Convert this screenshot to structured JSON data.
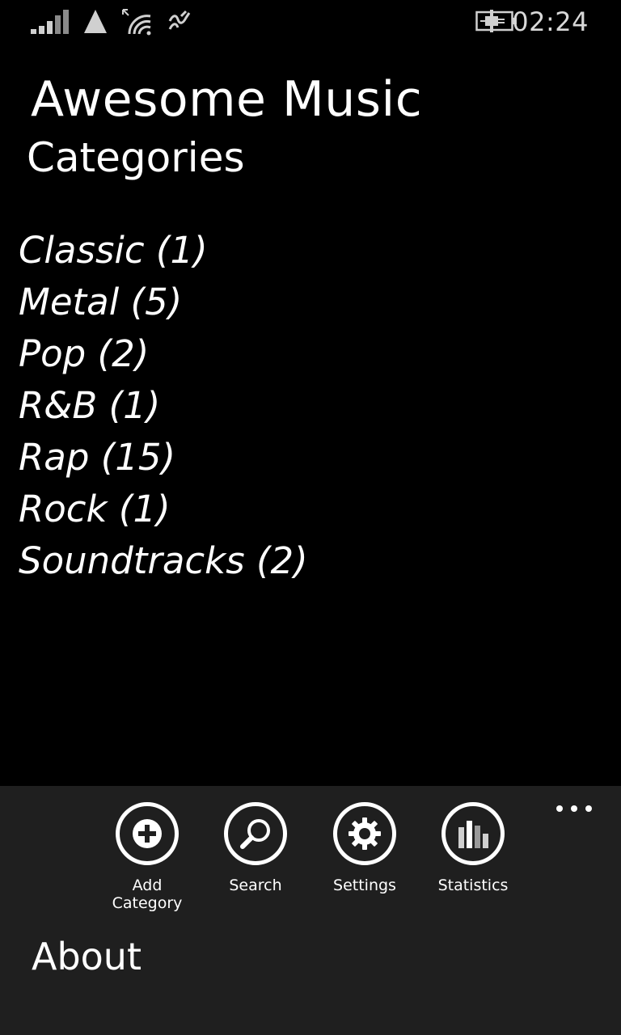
{
  "status_bar": {
    "time": "02:24",
    "icons": [
      "signal-strength-icon",
      "network-triangle-icon",
      "wifi-icon",
      "data-sync-icon",
      "battery-charging-icon"
    ]
  },
  "header": {
    "app_title": "Awesome Music",
    "page_title": "Categories"
  },
  "categories": [
    "Classic (1)",
    "Metal (5)",
    "Pop (2)",
    "R&B (1)",
    "Rap (15)",
    "Rock (1)",
    "Soundtracks (2)"
  ],
  "app_bar": {
    "buttons": [
      {
        "label": "Add\nCategory",
        "icon": "add-icon"
      },
      {
        "label": "Search",
        "icon": "search-icon"
      },
      {
        "label": "Settings",
        "icon": "gear-icon"
      },
      {
        "label": "Statistics",
        "icon": "bar-chart-icon"
      }
    ],
    "menu_items": [
      "About"
    ],
    "more_icon": "ellipsis-icon"
  },
  "colors": {
    "background": "#000000",
    "app_bar_background": "#1f1f1f",
    "foreground": "#ffffff"
  }
}
